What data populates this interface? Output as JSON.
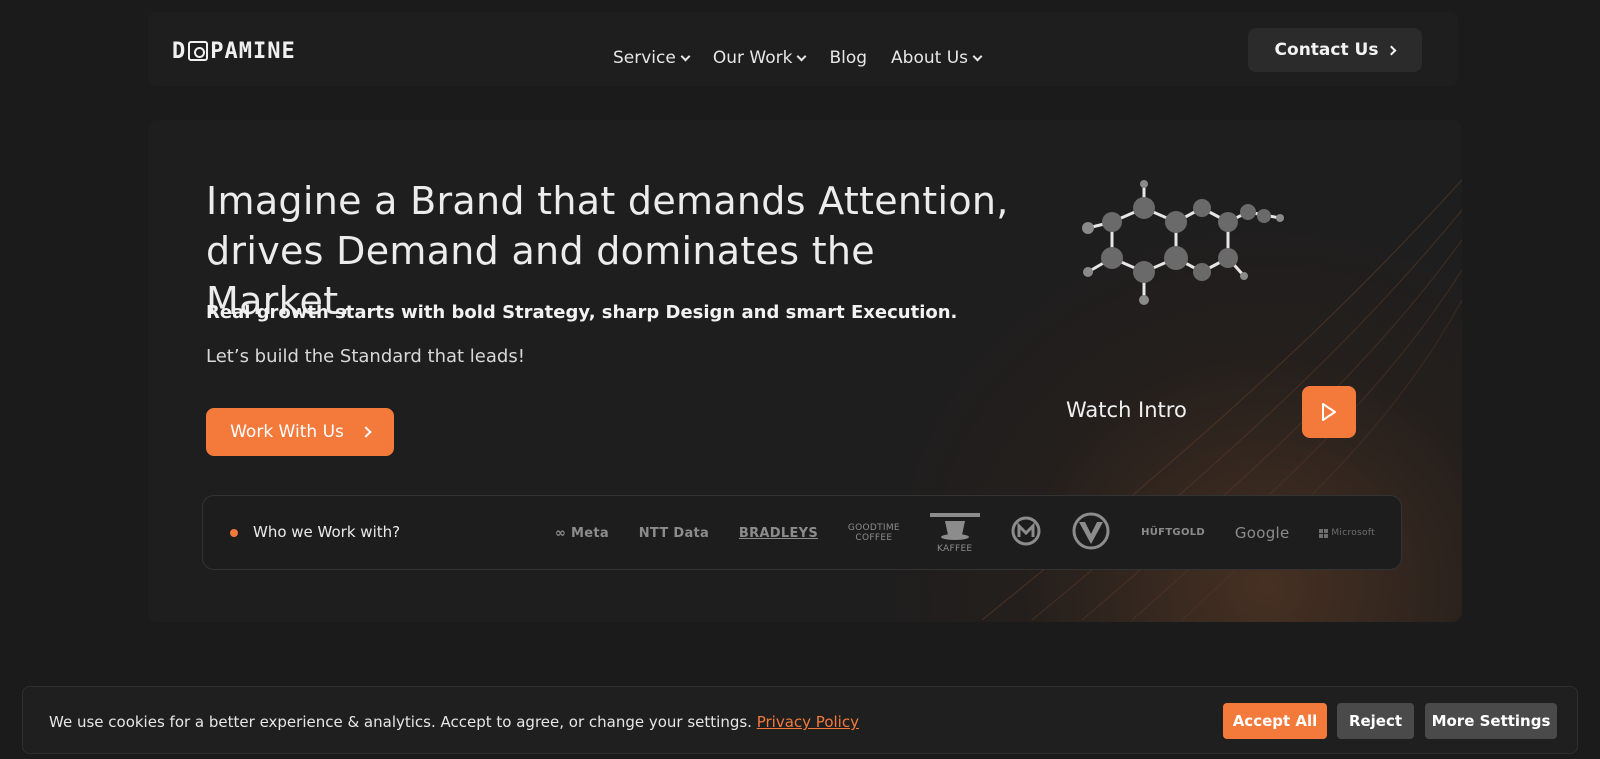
{
  "nav": {
    "logo": "D PAMINE",
    "links": [
      "Service",
      "Our Work",
      "Blog",
      "About Us"
    ],
    "contact": "Contact Us"
  },
  "hero": {
    "headline_line1": "Imagine a Brand that demands Attention,",
    "headline_line2": "drives Demand and dominates the Market.",
    "subline": "Real growth starts with bold Strategy, sharp Design and smart Execution.",
    "tagline": "Let’s build the Standard that leads!",
    "cta": "Work With Us",
    "watch": "Watch Intro"
  },
  "clients": {
    "label": "Who we Work with?",
    "logos": [
      "Meta",
      "NTT Data",
      "BRADLEYS",
      "GOODTIME",
      "COFFEE",
      "KAFFEE",
      "HÜFTGOLD",
      "Google",
      "Microsoft"
    ]
  },
  "cookie": {
    "text": "We use cookies for a better experience & analytics. Accept to agree, or change your settings.",
    "link": "Privacy Policy",
    "accept": "Accept All",
    "reject": "Reject",
    "more": "More Settings"
  },
  "colors": {
    "accent": "#f47a3c",
    "background": "#1b1b1b",
    "card": "#1e1e1e"
  }
}
